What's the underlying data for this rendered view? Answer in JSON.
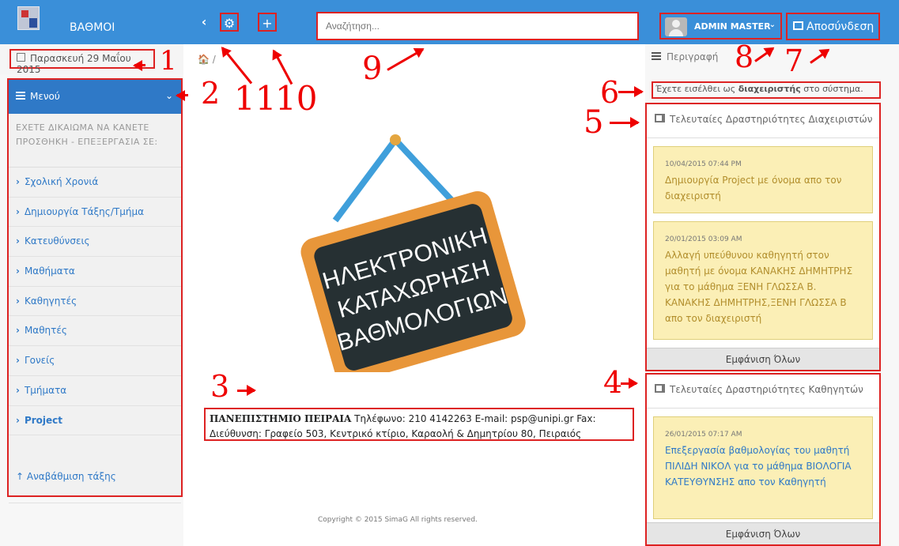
{
  "brand": {
    "title": "ΒΑΘΜΟΙ"
  },
  "topbar": {
    "search_placeholder": "Αναζήτηση...",
    "admin_name": "ADMIN MASTER",
    "logout_label": "Αποσύνδεση"
  },
  "date": {
    "label": "Παρασκευή 29 Μαΐου 2015"
  },
  "sidebar": {
    "menu_title": "Μενού",
    "permissions_text": "ΕΧΕΤΕ ΔΙΚΑΙΩΜΑ ΝΑ ΚΑΝΕΤΕ ΠΡΟΣΘΗΚΗ - ΕΠΕΞΕΡΓΑΣΙΑ ΣΕ:",
    "items": [
      {
        "label": "Σχολική Χρονιά"
      },
      {
        "label": "Δημιουργία Τάξης/Τμήμα"
      },
      {
        "label": "Κατευθύνσεις"
      },
      {
        "label": "Μαθήματα"
      },
      {
        "label": "Καθηγητές"
      },
      {
        "label": "Μαθητές"
      },
      {
        "label": "Γονείς"
      },
      {
        "label": "Τμήματα"
      },
      {
        "label": "Project"
      }
    ],
    "bottom_action": "Αναβάθμιση τάξης"
  },
  "center": {
    "breadcrumb": "🏠 /",
    "board_lines": [
      "ΗΛΕΚΤΡΟΝΙΚΗ",
      "ΚΑΤΑΧΩΡΗΣΗ",
      "ΒΑΘΜΟΛΟΓΙΩΝ"
    ],
    "address": {
      "university": "ΠΑΝΕΠΙΣΤΗΜΙΟ ΠΕΙΡΑΙΑ",
      "phone": "Τηλέφωνο: 210 4142263",
      "email": "E-mail: psp@unipi.gr",
      "fax": "Fax:",
      "line2": "Διεύθυνση: Γραφείο 503, Κεντρικό κτίριο, Καραολή & Δημητρίου 80, Πειραιός"
    },
    "copyright": "Copyright © 2015 SimaG All rights reserved."
  },
  "right": {
    "description_label": "Περιγραφή",
    "logged_in_text": "Έχετε εισέλθει ως",
    "logged_in_role": "διαχειριστής",
    "logged_in_suffix": "στο σύστημα.",
    "admin_panel": {
      "title": "Τελευταίες Δραστηριότητες Διαχειριστών",
      "activities": [
        {
          "date": "10/04/2015 07:44 PM",
          "text": "Δημιουργία Project με όνομα   απο τον διαχειριστή"
        },
        {
          "date": "20/01/2015 03:09 AM",
          "text": "Αλλαγή υπεύθυνου καθηγητή στον μαθητή με όνομα ΚΑΝΑΚΗΣ ΔΗΜΗΤΡΗΣ για το μάθημα ΞΕΝΗ ΓΛΩΣΣΑ Β. ΚΑΝΑΚΗΣ ΔΗΜΗΤΡΗΣ,ΞΕΝΗ ΓΛΩΣΣΑ Β απο τον διαχειριστή"
        }
      ],
      "show_all": "Εμφάνιση Όλων"
    },
    "teacher_panel": {
      "title": "Τελευταίες Δραστηριότητες Καθηγητών",
      "activities": [
        {
          "date": "26/01/2015 07:17 AM",
          "text": "Επεξεργασία βαθμολογίας του μαθητή ΠΙΛΙΔΗ ΝΙΚΟΛ για το μάθημα ΒΙΟΛΟΓΙΑ ΚΑΤΕΥΘΥΝΣΗΣ απο τον Καθηγητή"
        }
      ],
      "show_all": "Εμφάνιση Όλων"
    }
  },
  "annotations": {
    "n1": "1",
    "n2": "2",
    "n3": "3",
    "n4": "4",
    "n5": "5",
    "n6": "6",
    "n7": "7",
    "n8": "8",
    "n9": "9",
    "n10": "10",
    "n11": "11"
  },
  "colors": {
    "topbar": "#3a8fd9",
    "sidebar_head": "#2f79c7",
    "annotation_red": "#e00",
    "activity_yellow": "#fbefb6"
  }
}
